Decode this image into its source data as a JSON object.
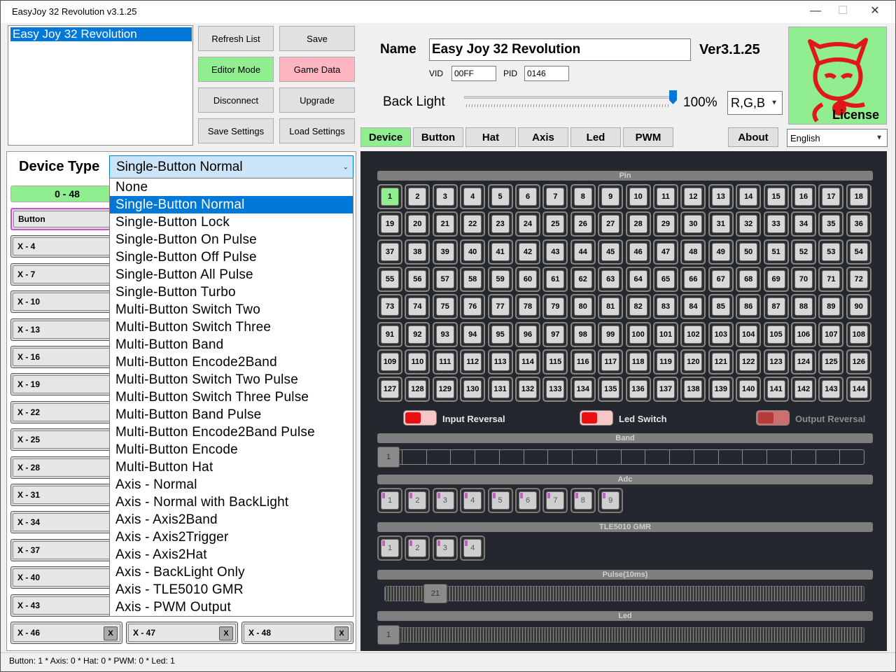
{
  "window": {
    "title": "EasyJoy 32 Revolution v3.1.25",
    "min": "—",
    "max": "☐",
    "close": "✕"
  },
  "device_list": [
    "Easy Joy 32 Revolution"
  ],
  "buttons": {
    "refresh": "Refresh List",
    "save": "Save",
    "editor": "Editor Mode",
    "gamedata": "Game Data",
    "disconnect": "Disconnect",
    "upgrade": "Upgrade",
    "save_settings": "Save Settings",
    "load_settings": "Load Settings",
    "about": "About"
  },
  "name_label": "Name",
  "name_value": "Easy Joy 32 Revolution",
  "version": "Ver3.1.25",
  "vid_label": "VID",
  "vid_value": "00FF",
  "pid_label": "PID",
  "pid_value": "0146",
  "backlight_label": "Back Light",
  "backlight_percent": "100%",
  "backlight_level": 1.0,
  "color_mode": "R,G,B",
  "license_label": "License",
  "language": "English",
  "tabs": [
    "Device",
    "Button",
    "Hat",
    "Axis",
    "Led",
    "PWM"
  ],
  "device_type_label": "Device Type",
  "device_type_value": "Single-Button Normal",
  "range_label": "0 - 48",
  "slots": [
    "Button",
    "X - 4",
    "X - 7",
    "X - 10",
    "X - 13",
    "X - 16",
    "X - 19",
    "X - 22",
    "X - 25",
    "X - 28",
    "X - 31",
    "X - 34",
    "X - 37",
    "X - 40",
    "X - 43",
    "X - 46",
    "X - 47",
    "X - 48"
  ],
  "slot_close": "X",
  "dropdown_options": [
    "None",
    "Single-Button Normal",
    "Single-Button Lock",
    "Single-Button On Pulse",
    "Single-Button Off Pulse",
    "Single-Button All Pulse",
    "Single-Button Turbo",
    "Multi-Button Switch Two",
    "Multi-Button Switch Three",
    "Multi-Button Band",
    "Multi-Button Encode2Band",
    "Multi-Button Switch Two Pulse",
    "Multi-Button Switch Three Pulse",
    "Multi-Button Band Pulse",
    "Multi-Button Encode2Band Pulse",
    "Multi-Button Encode",
    "Multi-Button Hat",
    "Axis - Normal",
    "Axis - Normal with BackLight",
    "Axis - Axis2Band",
    "Axis - Axis2Trigger",
    "Axis - Axis2Hat",
    "Axis - BackLight Only",
    "Axis - TLE5010 GMR",
    "Axis - PWM Output"
  ],
  "dropdown_selected": 1,
  "sections": {
    "pin": "Pin",
    "band": "Band",
    "adc": "Adc",
    "tle": "TLE5010 GMR",
    "pulse": "Pulse(10ms)",
    "led": "Led"
  },
  "pins_total": 144,
  "active_pin": 1,
  "toggles": {
    "input_reversal": "Input Reversal",
    "led_switch": "Led Switch",
    "output_reversal": "Output Reversal"
  },
  "band_value": "1",
  "adc_chips": [
    "1",
    "2",
    "3",
    "4",
    "5",
    "6",
    "7",
    "8",
    "9"
  ],
  "tle_chips": [
    "1",
    "2",
    "3",
    "4"
  ],
  "pulse_value": "21",
  "led_value": "1",
  "status": "Button: 1   * Axis: 0   * Hat: 0   * PWM: 0   * Led: 1"
}
